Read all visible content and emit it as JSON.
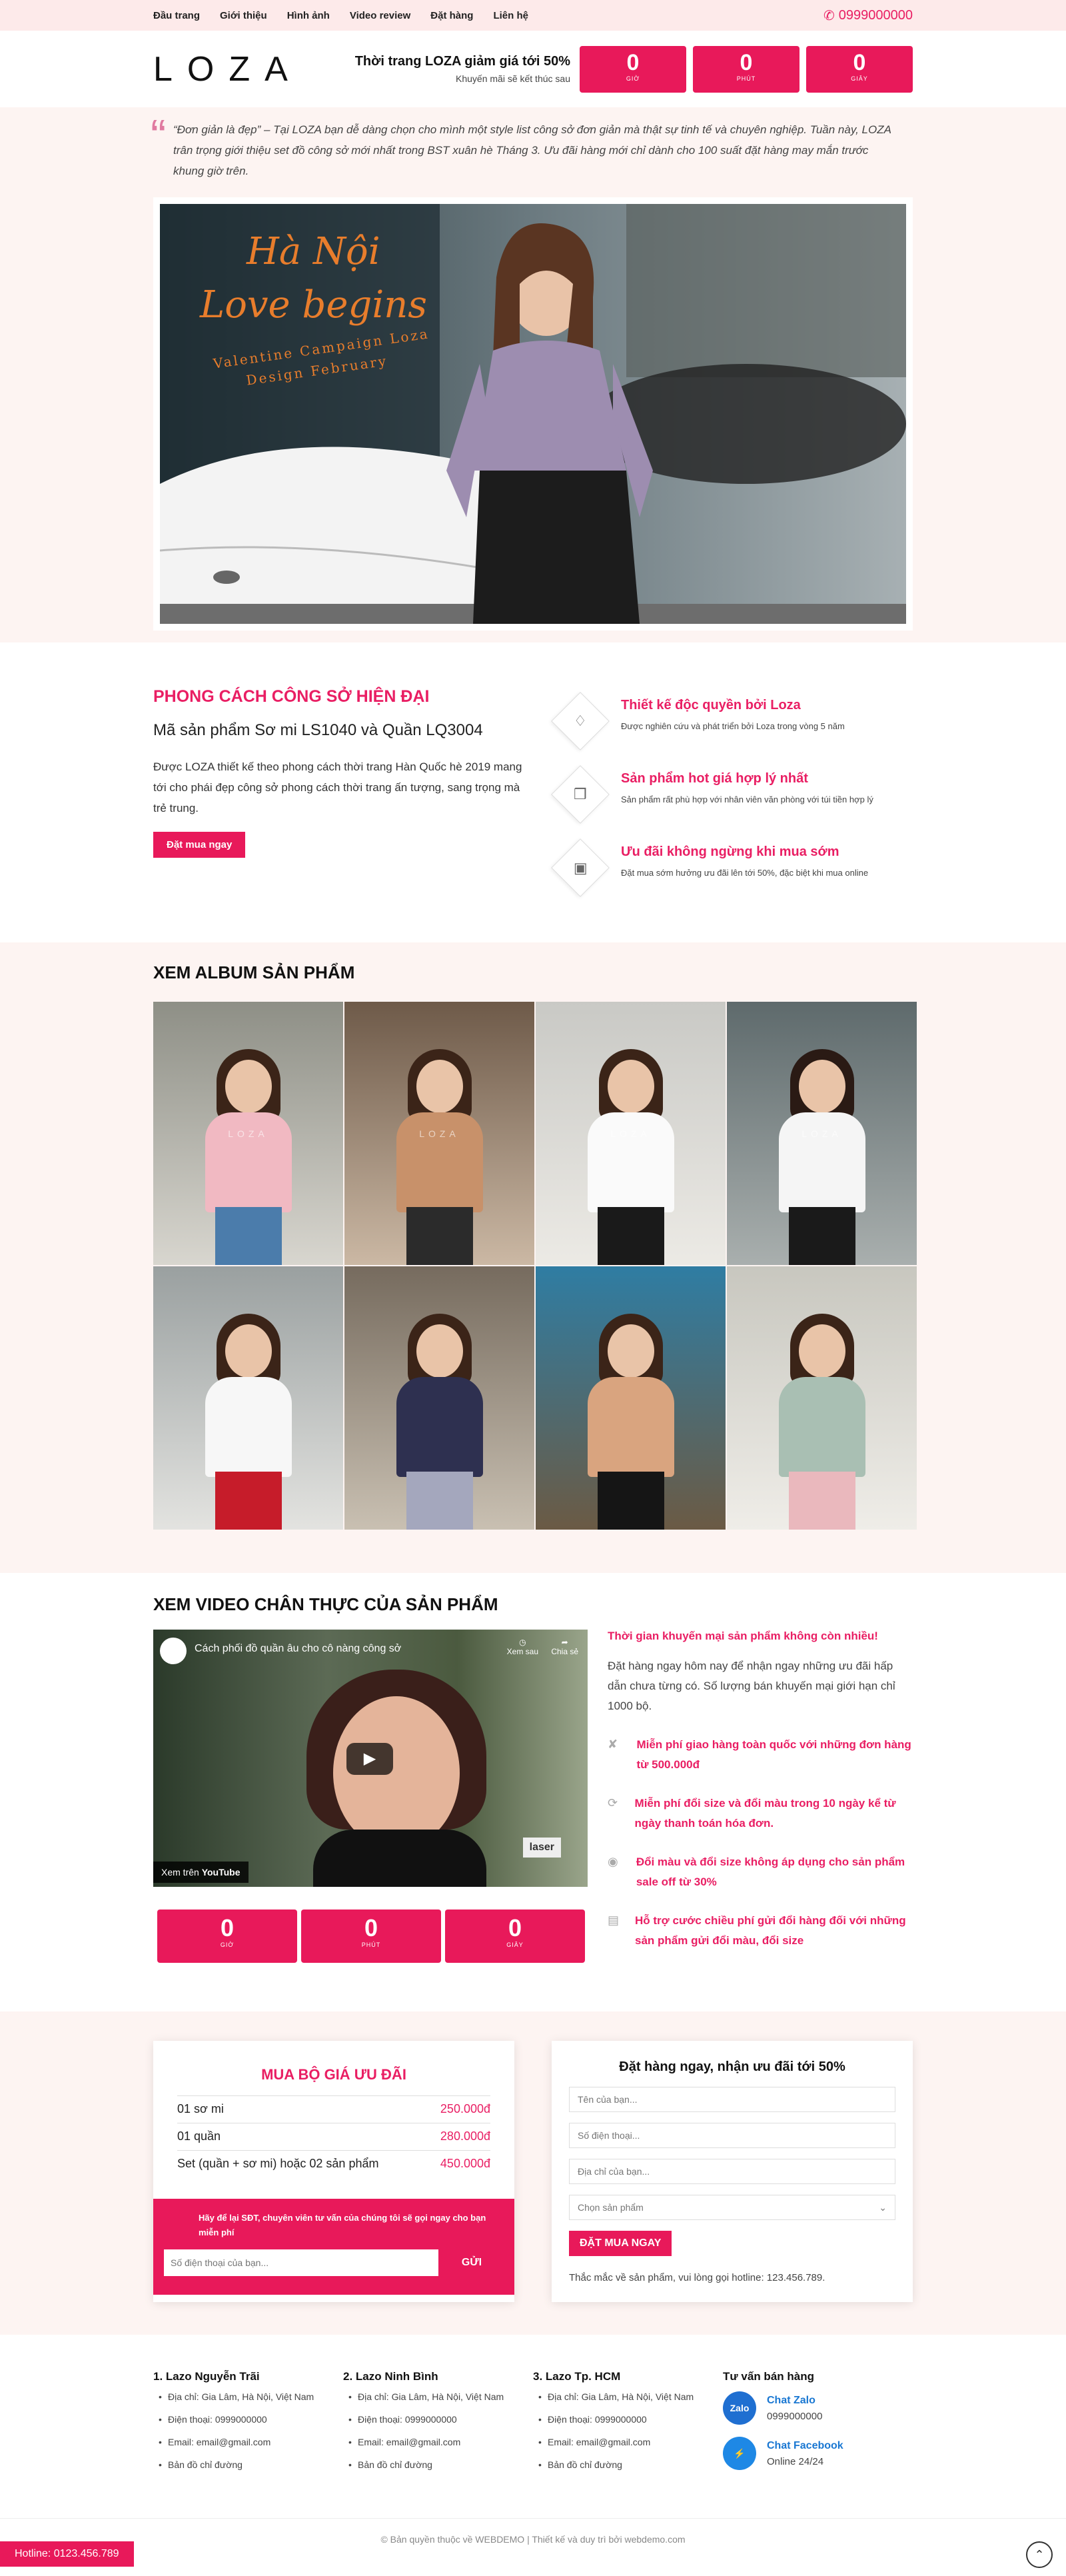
{
  "topbar": {
    "nav": [
      "Đầu trang",
      "Giới thiệu",
      "Hình ảnh",
      "Video review",
      "Đặt hàng",
      "Liên hệ"
    ],
    "phone": "0999000000"
  },
  "header": {
    "logo": "LOZA",
    "promo_title": "Thời trang LOZA giảm giá tới 50%",
    "promo_sub": "Khuyến mãi sẽ kết thúc sau",
    "countdown": [
      {
        "n": "0",
        "l": "GIỜ"
      },
      {
        "n": "0",
        "l": "PHÚT"
      },
      {
        "n": "0",
        "l": "GIÂY"
      }
    ]
  },
  "hero": {
    "quote": "“Đơn giản là đẹp” – Tại LOZA bạn dễ dàng chọn cho mình một style list công sở đơn giản mà thật sự tinh tế và chuyên nghiệp. Tuần này, LOZA trân trọng giới thiệu set đồ công sở mới nhất trong BST xuân hè Tháng 3. Ưu đãi hàng mới chỉ dành cho 100 suất đặt hàng may mắn trước khung giờ trên.",
    "img_line1": "Hà Nội",
    "img_line2": "Love begins",
    "img_line3": "Valentine Campaign Loza",
    "img_line4": "Design February"
  },
  "features": {
    "title": "PHONG CÁCH CÔNG SỞ HIỆN ĐẠI",
    "subtitle": "Mã sản phẩm Sơ mi LS1040 và Quần LQ3004",
    "text": "Được LOZA thiết kế theo phong cách thời trang Hàn Quốc hè 2019 mang tới cho phái đẹp công sở phong cách thời trang ấn tượng, sang trọng mà trẻ trung.",
    "button": "Đặt mua ngay",
    "items": [
      {
        "icon": "diamond-icon",
        "title": "Thiết kế độc quyền bởi Loza",
        "text": "Được nghiên cứu và phát triển bởi Loza trong vòng 5 năm"
      },
      {
        "icon": "tag-icon",
        "title": "Sản phẩm hot giá hợp lý nhất",
        "text": "Sản phẩm rất phù hợp với nhân viên văn phòng với túi tiền hợp lý"
      },
      {
        "icon": "bag-icon",
        "title": "Ưu đãi không ngừng khi mua sớm",
        "text": "Đặt mua sớm hưởng ưu đãi lên tới 50%, đặc biệt khi mua online"
      }
    ]
  },
  "album": {
    "title": "XEM ALBUM SẢN PHẨM",
    "watermark": "LOZA"
  },
  "video": {
    "title": "XEM VIDEO CHÂN THỰC CỦA SẢN PHẨM",
    "video_title": "Cách phối đồ quần âu cho cô nàng công sở",
    "watch_later": "Xem sau",
    "share": "Chia sẻ",
    "watch_on": "Xem trên",
    "youtube": "YouTube",
    "tag": "laser",
    "countdown": [
      {
        "n": "0",
        "l": "GIỜ"
      },
      {
        "n": "0",
        "l": "PHÚT"
      },
      {
        "n": "0",
        "l": "GIÂY"
      }
    ],
    "headline": "Thời gian khuyến mại sản phẩm không còn nhiều!",
    "text": "Đặt hàng ngay hôm nay để nhận ngay những ưu đãi hấp dẫn chưa từng có. Số lượng bán khuyến mại giới hạn chỉ 1000 bộ.",
    "items": [
      "Miễn phí giao hàng toàn quốc với những đơn hàng từ 500.000đ",
      "Miễn phí đổi size và đổi màu trong 10 ngày kể từ ngày thanh toán hóa đơn.",
      "Đổi màu và đổi size không áp dụng cho sản phẩm sale off từ 30%",
      "Hỗ trợ cước chiều phí gửi đổi hàng đối với những sản phẩm gửi đổi màu, đổi size"
    ]
  },
  "pricing": {
    "title": "MUA BỘ GIÁ ƯU ĐÃI",
    "rows": [
      {
        "name": "01 sơ mi",
        "price": "250.000đ"
      },
      {
        "name": "01 quần",
        "price": "280.000đ"
      },
      {
        "name": "Set (quần + sơ mi) hoặc 02 sản phẩm",
        "price": "450.000đ"
      }
    ],
    "band_text": "Hãy để lại SĐT, chuyên viên tư vấn của chúng tôi sẽ gọi ngay cho bạn miễn phí",
    "phone_placeholder": "Số điện thoại của bạn...",
    "send": "GỬI"
  },
  "form": {
    "title": "Đặt hàng ngay, nhận ưu đãi tới 50%",
    "name": "Tên của bạn...",
    "phone": "Số điện thoại...",
    "address": "Địa chỉ của bạn...",
    "select": "Chọn sản phẩm",
    "submit": "ĐẶT MUA NGAY",
    "note": "Thắc mắc về sản phẩm, vui lòng gọi hotline: 123.456.789."
  },
  "footer": {
    "cols": [
      {
        "title": "1. Lazo Nguyễn Trãi",
        "items": [
          "Địa chỉ: Gia Lâm, Hà Nội, Việt Nam",
          "Điện thoại: 0999000000",
          "Email: email@gmail.com",
          "Bản đồ chỉ đường"
        ]
      },
      {
        "title": "2. Lazo Ninh Bình",
        "items": [
          "Địa chỉ: Gia Lâm, Hà Nội, Việt Nam",
          "Điện thoại: 0999000000",
          "Email: email@gmail.com",
          "Bản đồ chỉ đường"
        ]
      },
      {
        "title": "3. Lazo Tp. HCM",
        "items": [
          "Địa chỉ: Gia Lâm, Hà Nội, Việt Nam",
          "Điện thoại: 0999000000",
          "Email: email@gmail.com",
          "Bản đồ chỉ đường"
        ]
      }
    ],
    "consult_title": "Tư vấn bán hàng",
    "zalo": "Chat Zalo",
    "zalo_sub": "0999000000",
    "zalo_icon": "Zalo",
    "fb": "Chat Facebook",
    "fb_sub": "Online 24/24",
    "copyright": "© Bản quyền thuộc về WEBDEMO | Thiết kế và duy trì bởi webdemo.com",
    "hotline": "Hotline: 0123.456.789"
  }
}
